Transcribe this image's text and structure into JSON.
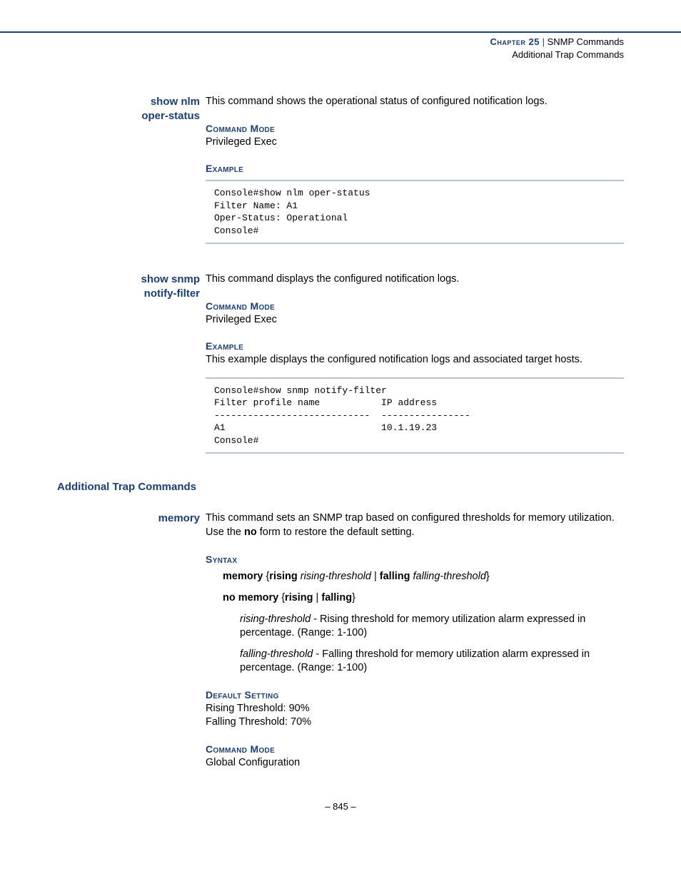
{
  "header": {
    "chapter_label": "Chapter 25",
    "separator": "|",
    "chapter_title": "SNMP Commands",
    "subtitle": "Additional Trap Commands"
  },
  "cmd1": {
    "name_line1": "show nlm",
    "name_line2": "oper-status",
    "desc": "This command shows the operational status of configured notification logs.",
    "mode_label": "Command Mode",
    "mode_value": "Privileged Exec",
    "example_label": "Example",
    "code": "Console#show nlm oper-status\nFilter Name: A1\nOper-Status: Operational\nConsole#"
  },
  "cmd2": {
    "name_line1": "show snmp",
    "name_line2": "notify-filter",
    "desc": "This command displays the configured notification logs.",
    "mode_label": "Command Mode",
    "mode_value": "Privileged Exec",
    "example_label": "Example",
    "example_text": "This example displays the configured notification logs and associated target hosts.",
    "code": "Console#show snmp notify-filter\nFilter profile name           IP address\n----------------------------  ----------------\nA1                            10.1.19.23\nConsole#"
  },
  "section2_heading": "Additional Trap Commands",
  "cmd3": {
    "name": "memory",
    "desc_part1": "This command sets an SNMP trap based on configured thresholds for memory utilization. Use the ",
    "desc_bold": "no",
    "desc_part2": " form to restore the default setting.",
    "syntax_label": "Syntax",
    "syntax1_b1": "memory",
    "syntax1_p1": " {",
    "syntax1_b2": "rising",
    "syntax1_i1": " rising-threshold",
    "syntax1_p2": " | ",
    "syntax1_b3": "falling",
    "syntax1_i2": " falling-threshold",
    "syntax1_p3": "}",
    "syntax2_b1": "no memory",
    "syntax2_p1": " {",
    "syntax2_b2": "rising",
    "syntax2_p2": " | ",
    "syntax2_b3": "falling",
    "syntax2_p3": "}",
    "param1_i": "rising-threshold",
    "param1_t": " - Rising threshold for memory utilization alarm expressed in percentage. (Range: 1-100)",
    "param2_i": "falling-threshold",
    "param2_t": " - Falling threshold for memory utilization alarm expressed in percentage. (Range: 1-100)",
    "default_label": "Default Setting",
    "default_v1": "Rising Threshold: 90%",
    "default_v2": "Falling Threshold: 70%",
    "mode_label": "Command Mode",
    "mode_value": "Global Configuration"
  },
  "footer": "–  845  –"
}
